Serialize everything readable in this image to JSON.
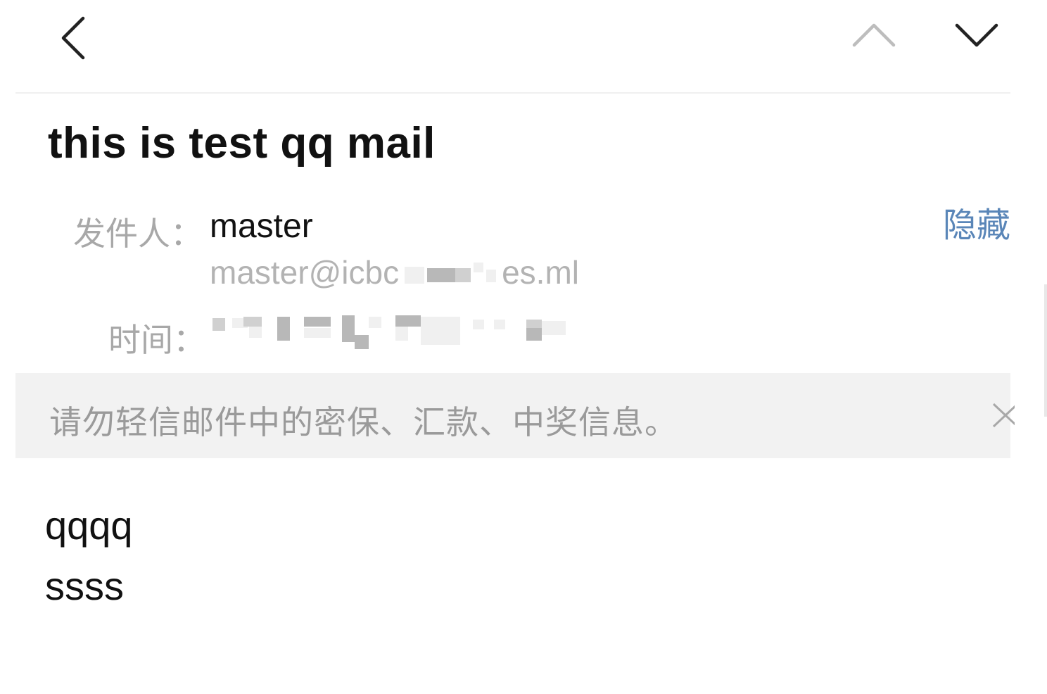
{
  "nav": {
    "back_icon": "chevron-left-icon",
    "prev_icon": "chevron-up-icon",
    "next_icon": "chevron-down-icon"
  },
  "mail": {
    "subject": "this is test qq mail",
    "sender_label": "发件人：",
    "sender_name": "master",
    "sender_email_prefix": "master@icbc",
    "sender_email_suffix": "es.ml",
    "time_label": "时间：",
    "hide_label": "隐藏"
  },
  "notice": {
    "text": "请勿轻信邮件中的密保、汇款、中奖信息。",
    "close_icon": "close-icon"
  },
  "body": {
    "lines": [
      "qqqq",
      "ssss"
    ]
  },
  "colors": {
    "link": "#5a86b8",
    "label": "#a8a8a8",
    "notice_bg": "#f2f2f2"
  }
}
